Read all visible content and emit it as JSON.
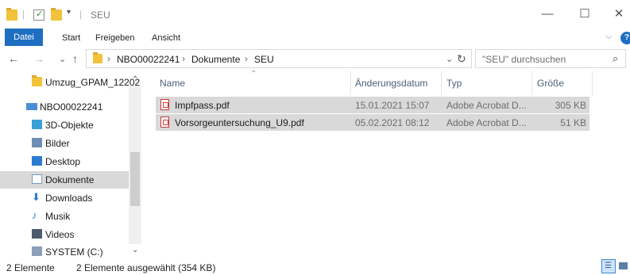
{
  "window": {
    "title": "SEU",
    "controls": {
      "minimize": "—",
      "maximize": "☐",
      "close": "✕"
    }
  },
  "ribbon": {
    "tabs": [
      "Datei",
      "Start",
      "Freigeben",
      "Ansicht"
    ]
  },
  "address": {
    "path": [
      "NBO00022241",
      "Dokumente",
      "SEU"
    ],
    "search_placeholder": "\"SEU\" durchsuchen"
  },
  "nav_pane": {
    "items": [
      {
        "label": "Umzug_GPAM_12202",
        "icon": "folder-icon"
      },
      {
        "label": "NBO00022241",
        "icon": "computer-icon"
      },
      {
        "label": "3D-Objekte",
        "icon": "3d-objects-icon"
      },
      {
        "label": "Bilder",
        "icon": "pictures-icon"
      },
      {
        "label": "Desktop",
        "icon": "desktop-icon"
      },
      {
        "label": "Dokumente",
        "icon": "documents-icon",
        "selected": true
      },
      {
        "label": "Downloads",
        "icon": "downloads-icon"
      },
      {
        "label": "Musik",
        "icon": "music-icon"
      },
      {
        "label": "Videos",
        "icon": "videos-icon"
      },
      {
        "label": "SYSTEM (C:)",
        "icon": "drive-icon"
      }
    ]
  },
  "columns": {
    "name": "Name",
    "date": "Änderungsdatum",
    "type": "Typ",
    "size": "Größe"
  },
  "files": [
    {
      "name": "Impfpass.pdf",
      "date": "15.01.2021 15:07",
      "type": "Adobe Acrobat D...",
      "size": "305 KB"
    },
    {
      "name": "Vorsorgeuntersuchung_U9.pdf",
      "date": "05.02.2021 08:12",
      "type": "Adobe Acrobat D...",
      "size": "51 KB"
    }
  ],
  "status": {
    "count": "2 Elemente",
    "selection": "2 Elemente ausgewählt (354 KB)"
  },
  "colors": {
    "accent": "#1e6fc2",
    "selection": "#d9d9d9",
    "folder": "#f2c23a"
  }
}
